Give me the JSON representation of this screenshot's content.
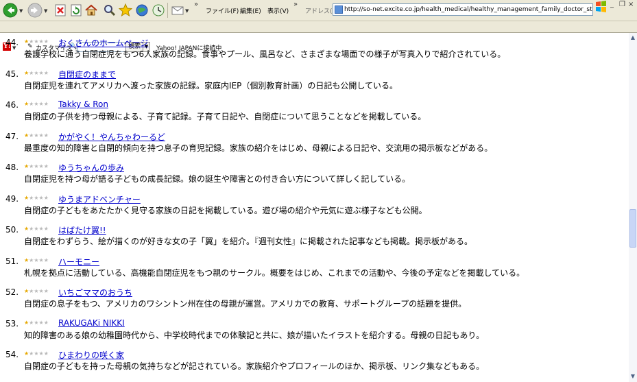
{
  "menu": {
    "file": "ファイル(F)",
    "edit": "編集(E)",
    "view": "表示(V)"
  },
  "address": {
    "label": "アドレス(D)",
    "url": "http://so-net.excite.co.jp/health_medical/healthy_management_family_doctor_study/chil"
  },
  "toolbar2": {
    "customize": "カスタマイズ",
    "search_label": "検索",
    "yahoo_link": "Yahoo! JAPANに接続中"
  },
  "rating_stars": {
    "filled": 1,
    "total": 5
  },
  "entries": [
    {
      "num": "44.",
      "title": "おくさんのホームページ",
      "desc": "養護学校に通う自閉症児をもつ6人家族の記録。食事やプール、風呂など、さまざまな場面での様子が写真入りで紹介されている。"
    },
    {
      "num": "45.",
      "title": "自閉症のままで",
      "desc": "自閉症児を連れてアメリカへ渡った家族の記録。家庭内IEP（個別教育計画）の日記も公開している。"
    },
    {
      "num": "46.",
      "title": "Takky & Ron",
      "desc": "自閉症の子供を持つ母親による、子育て記録。子育て日記や、自閉症について思うことなどを掲載している。"
    },
    {
      "num": "47.",
      "title": "かがやく！やんちゃわーるど",
      "desc": "最重度の知的障害と自閉的傾向を持つ息子の育児記録。家族の紹介をはじめ、母親による日記や、交流用の掲示板などがある。"
    },
    {
      "num": "48.",
      "title": "ゆうちゃんの歩み",
      "desc": "自閉症児を持つ母が語る子どもの成長記録。娘の誕生や障害との付き合い方について詳しく記している。"
    },
    {
      "num": "49.",
      "title": "ゆうまアドベンチャー",
      "desc": "自閉症の子どもをあたたかく見守る家族の日記を掲載している。遊び場の紹介や元気に遊ぶ様子なども公開。"
    },
    {
      "num": "50.",
      "title": "はばたけ翼!!",
      "desc": "自閉症をわずらう、絵が描くのが好きな女の子「翼」を紹介。『週刊女性』に掲載された記事なども掲載。掲示板がある。"
    },
    {
      "num": "51.",
      "title": "ハーモニー",
      "desc": "札幌を拠点に活動している、高機能自閉症児をもつ親のサークル。概要をはじめ、これまでの活動や、今後の予定などを掲載している。"
    },
    {
      "num": "52.",
      "title": "いちごママのおうち",
      "desc": "自閉症の息子をもつ、アメリカのワシントン州在住の母親が運営。アメリカでの教育、サポートグループの話題を提供。"
    },
    {
      "num": "53.",
      "title": "RAKUGAKi NIKKI",
      "desc": "知的障害のある娘の幼稚園時代から、中学校時代までの体験記と共に、娘が描いたイラストを紹介する。母親の日記もあり。"
    },
    {
      "num": "54.",
      "title": "ひまわりの咲く家",
      "desc": "自閉症の子どもを持った母親の気持ちなどが記されている。家族紹介やプロフィールのほか、掲示板、リンク集などもある。"
    }
  ]
}
